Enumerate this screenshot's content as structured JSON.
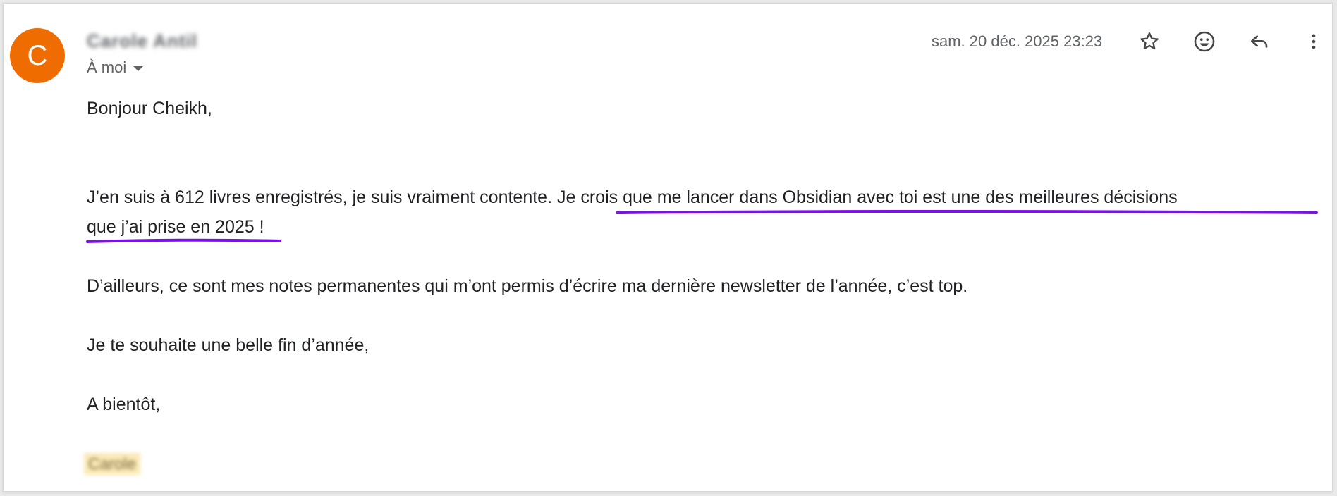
{
  "message": {
    "avatar_letter": "C",
    "avatar_color": "#ef6c00",
    "sender_name": "Carole Antil",
    "recipient_label": "À moi",
    "date": "sam. 20 déc. 2025 23:23"
  },
  "actions": {
    "star": "star-icon",
    "emoji": "emoji-icon",
    "reply": "reply-icon",
    "more": "more-vert-icon"
  },
  "body": {
    "greeting": "Bonjour Cheikh,",
    "p1_plain": "J’en suis à 612 livres enregistrés, je suis vraiment contente. ",
    "p1_highlight_line1": "Je crois que me lancer dans Obsidian avec toi est une des meilleures décisions",
    "p1_highlight_line2": "que j’ai prise en 2025",
    "p1_end": " !",
    "p2": "D’ailleurs, ce sont mes notes permanentes qui m’ont permis d’écrire ma dernière newsletter de l’année, c’est top.",
    "p3": "Je te souhaite une belle fin d’année,",
    "closing": "A bientôt,",
    "signature": "Carole"
  },
  "colors": {
    "underline": "#7a12e6",
    "signature_highlight": "#fbe9b7"
  }
}
